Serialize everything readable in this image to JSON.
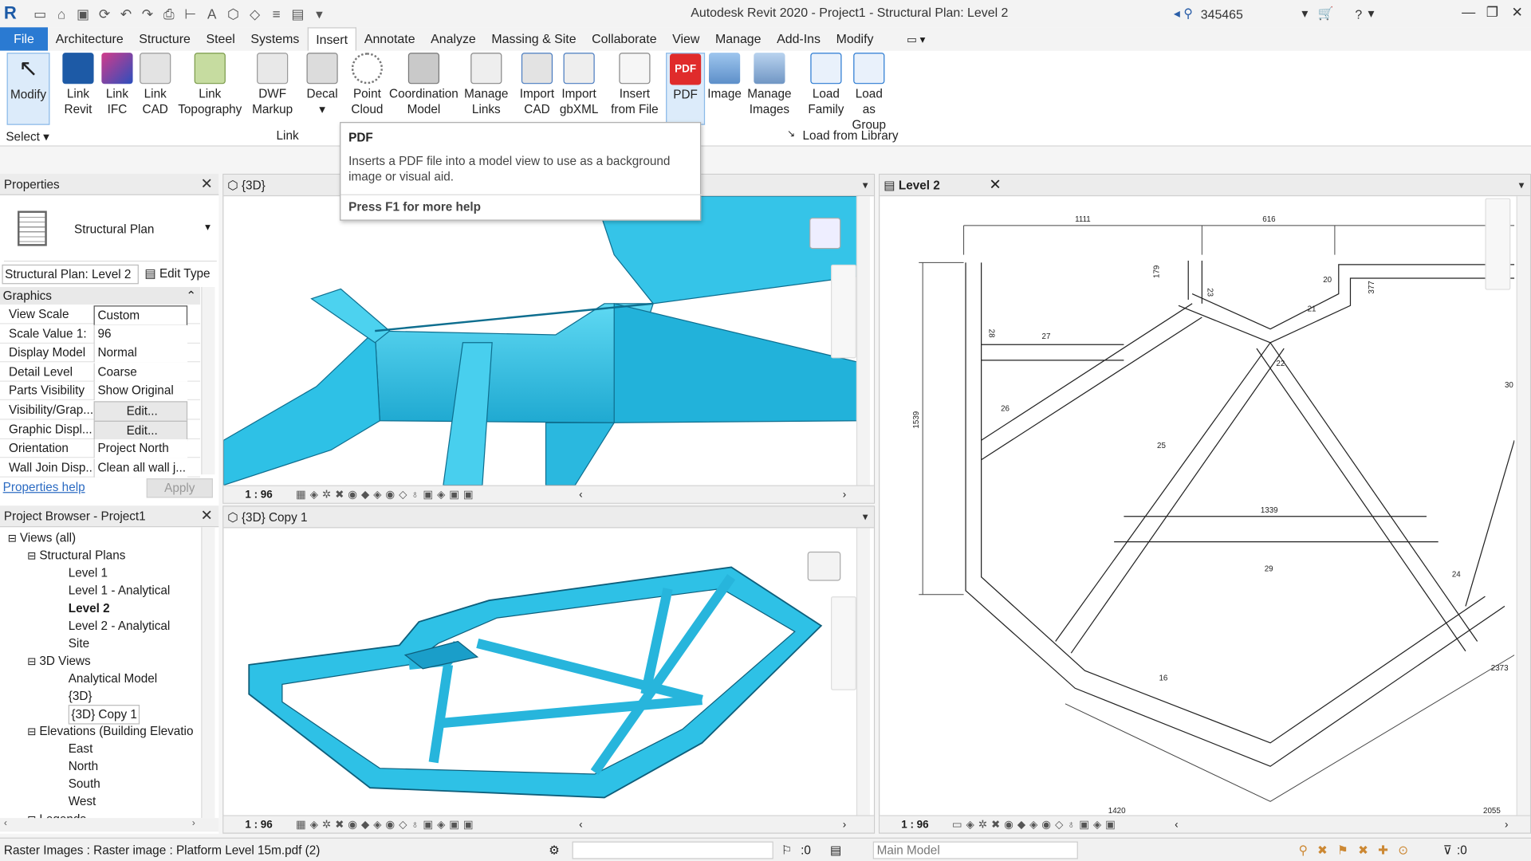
{
  "title": "Autodesk Revit 2020 - Project1 - Structural Plan: Level 2",
  "user": "345465",
  "menu": [
    "File",
    "Architecture",
    "Structure",
    "Steel",
    "Systems",
    "Insert",
    "Annotate",
    "Analyze",
    "Massing & Site",
    "Collaborate",
    "View",
    "Manage",
    "Add-Ins",
    "Modify"
  ],
  "ribbon": {
    "modify": "Modify",
    "link_revit": [
      "Link",
      "Revit"
    ],
    "link_ifc": [
      "Link",
      "IFC"
    ],
    "link_cad": [
      "Link",
      "CAD"
    ],
    "link_topo": [
      "Link",
      "Topography"
    ],
    "dwf": [
      "DWF",
      "Markup"
    ],
    "decal": "Decal",
    "point_cloud": [
      "Point",
      "Cloud"
    ],
    "coordination": [
      "Coordination",
      "Model"
    ],
    "manage_links": [
      "Manage",
      "Links"
    ],
    "import_cad": [
      "Import",
      "CAD"
    ],
    "import_gbxml": [
      "Import",
      "gbXML"
    ],
    "insert_file": [
      "Insert",
      "from File"
    ],
    "pdf": "PDF",
    "image": "Image",
    "manage_images": [
      "Manage",
      "Images"
    ],
    "load_family": [
      "Load",
      "Family"
    ],
    "load_group": [
      "Load as",
      "Group"
    ],
    "select_label": "Select",
    "link_label": "Link",
    "load_label": "Load from Library"
  },
  "tooltip": {
    "title": "PDF",
    "desc": "Inserts a PDF file into a model view to use as a background image or visual aid.",
    "help": "Press F1 for more help"
  },
  "properties": {
    "title": "Properties",
    "type": "Structural Plan",
    "selector": "Structural Plan: Level 2",
    "edit_type": "Edit Type",
    "group": "Graphics",
    "rows": [
      {
        "k": "View Scale",
        "v": "Custom"
      },
      {
        "k": "Scale Value    1:",
        "v": "96"
      },
      {
        "k": "Display Model",
        "v": "Normal"
      },
      {
        "k": "Detail Level",
        "v": "Coarse"
      },
      {
        "k": "Parts Visibility",
        "v": "Show Original"
      },
      {
        "k": "Visibility/Grap...",
        "v": "Edit..."
      },
      {
        "k": "Graphic Displ...",
        "v": "Edit..."
      },
      {
        "k": "Orientation",
        "v": "Project North"
      },
      {
        "k": "Wall Join Disp...",
        "v": "Clean all wall j..."
      }
    ],
    "help": "Properties help",
    "apply": "Apply"
  },
  "browser": {
    "title": "Project Browser - Project1",
    "items": [
      {
        "t": "Views (all)",
        "d": 0
      },
      {
        "t": "Structural Plans",
        "d": 1
      },
      {
        "t": "Level 1",
        "d": 2
      },
      {
        "t": "Level 1 - Analytical",
        "d": 2
      },
      {
        "t": "Level 2",
        "d": 2
      },
      {
        "t": "Level 2 - Analytical",
        "d": 2
      },
      {
        "t": "Site",
        "d": 2
      },
      {
        "t": "3D Views",
        "d": 1
      },
      {
        "t": "Analytical Model",
        "d": 2
      },
      {
        "t": "{3D}",
        "d": 2
      },
      {
        "t": "{3D} Copy 1",
        "d": 2
      },
      {
        "t": "Elevations (Building Elevatio",
        "d": 1
      },
      {
        "t": "East",
        "d": 2
      },
      {
        "t": "North",
        "d": 2
      },
      {
        "t": "South",
        "d": 2
      },
      {
        "t": "West",
        "d": 2
      },
      {
        "t": "Legends",
        "d": 1
      }
    ]
  },
  "views": {
    "v1": "{3D}",
    "v2": "{3D} Copy 1",
    "v3": "Level 2",
    "scale": "1 : 96"
  },
  "plan_dims": [
    "1111",
    "616",
    "179",
    "23",
    "20",
    "377",
    "28",
    "27",
    "21",
    "22",
    "26",
    "1539",
    "25",
    "30",
    "1339",
    "29",
    "24",
    "16",
    "2373",
    "1420",
    "2055"
  ],
  "status": {
    "text": "Raster Images : Raster image : Platform Level 15m.pdf (2)",
    "zero": ":0",
    "model": "Main Model",
    "filter": ":0"
  }
}
